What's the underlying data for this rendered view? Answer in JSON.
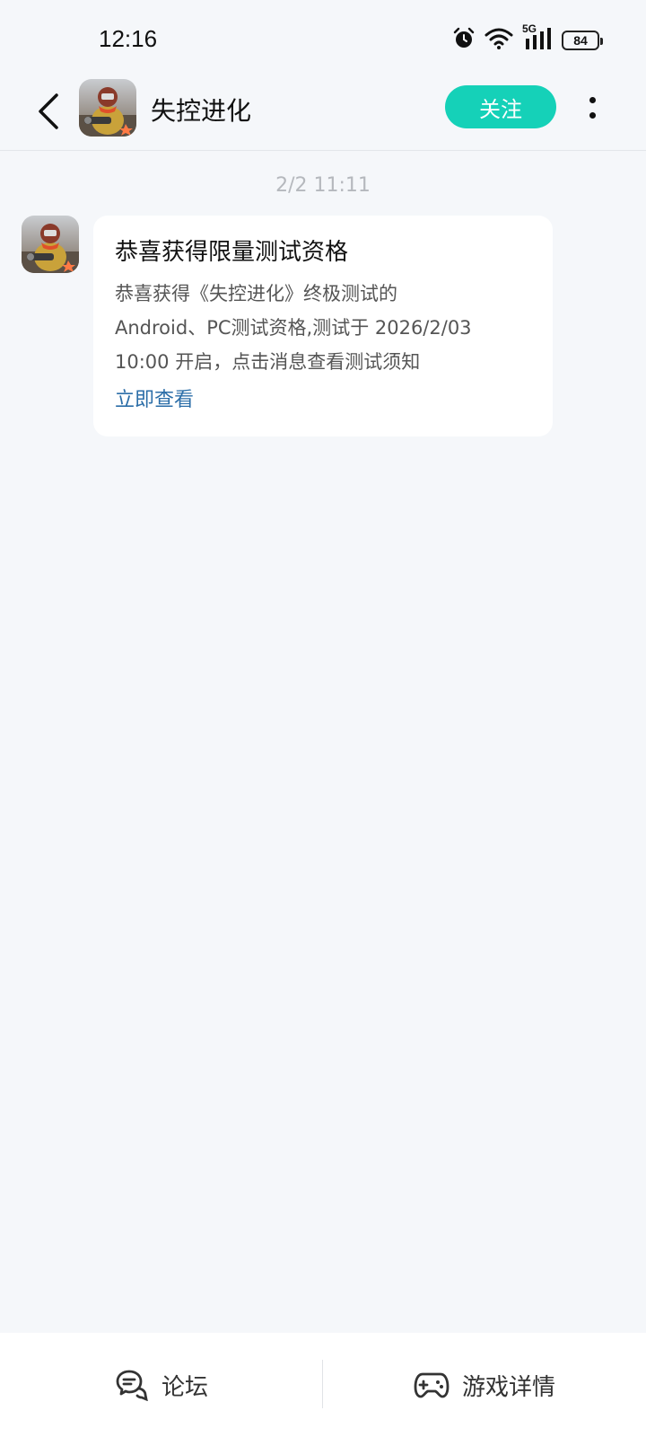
{
  "status_bar": {
    "time": "12:16",
    "network_label": "5G",
    "battery": "84"
  },
  "header": {
    "title": "失控进化",
    "follow_label": "关注"
  },
  "chat": {
    "timestamp": "2/2  11:11",
    "message": {
      "title": "恭喜获得限量测试资格",
      "body_line1": "恭喜获得《失控进化》终极测试的",
      "body_line2": "Android、PC测试资格,测试于 2026/2/03",
      "body_line3": "10:00 开启，点击消息查看测试须知",
      "link": "立即查看"
    }
  },
  "bottom_bar": {
    "forum_label": "论坛",
    "game_details_label": "游戏详情"
  },
  "colors": {
    "accent": "#15d1b8",
    "link": "#2c6ea8",
    "background": "#f5f7fa"
  }
}
